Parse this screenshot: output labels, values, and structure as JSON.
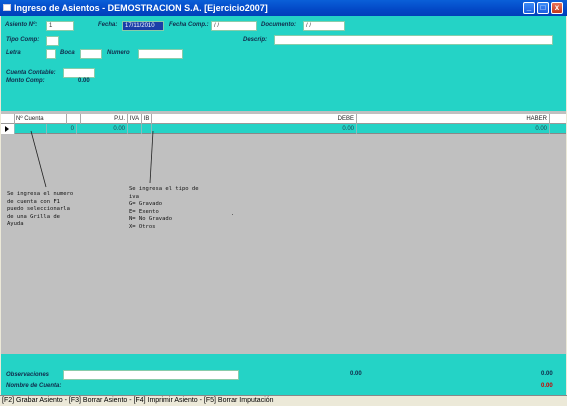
{
  "window": {
    "title": "Ingreso de Asientos - DEMOSTRACION S.A.  [Ejercicio2007]",
    "buttons": {
      "minimize": "_",
      "maximize": "□",
      "close": "x"
    }
  },
  "header": {
    "asiento_label": "Asiento Nº:",
    "asiento_value": "1",
    "fecha_label": "Fecha:",
    "fecha_value": "17/11/2010",
    "fecha_comp_label": "Fecha Comp.:",
    "fecha_comp_value": "/ /",
    "documento_label": "Documento:",
    "documento_value": "/ /",
    "tipo_comp_label": "Tipo Comp:",
    "tipo_comp_value": "",
    "descrip_label": "Descrip:",
    "descrip_value": "",
    "letra_label": "Letra",
    "letra_value": "",
    "boca_label": "Boca",
    "boca_value": "",
    "numero_label": "Numero",
    "numero_value": "",
    "cuenta_label": "Cuenta Contable:",
    "cuenta_value": "",
    "monto_label": "Monto Comp:",
    "monto_value": "0.00"
  },
  "grid": {
    "columns": [
      "Nº Cuenta",
      "",
      "P.U.",
      "IVA",
      "IB",
      "DEBE",
      "HABER"
    ],
    "row": {
      "cuenta": "",
      "nro": "0",
      "pu": "0.00",
      "iva": "",
      "ib": "",
      "debe": "0.00",
      "haber": "0.00"
    }
  },
  "notes": {
    "cuenta": "Se ingresa el numero\nde cuenta con F1\npuedo seleccionarla\nde una Grilla de\nAyuda",
    "iva": "Se ingresa el tipo de\niva\nG= Gravado\nE= Exento\nN= No Gravado\nX= Otros",
    "dot": "."
  },
  "footer": {
    "observaciones_label": "Observaciones",
    "observaciones_value": "",
    "total_debe": "0.00",
    "total_haber": "0.00",
    "nombre_cuenta_label": "Nombre de Cuenta:",
    "saldo": "0.00"
  },
  "statusbar": {
    "text": "[F2] Grabar Asiento - [F3] Borrar Asiento - [F4] Imprimir Asiento - [F5] Borrar Imputación"
  },
  "colors": {
    "panel": "#24d3c6",
    "grid_bg": "#c0c0c0",
    "titlebar": "#0348c6",
    "saldo": "#cc0000"
  }
}
